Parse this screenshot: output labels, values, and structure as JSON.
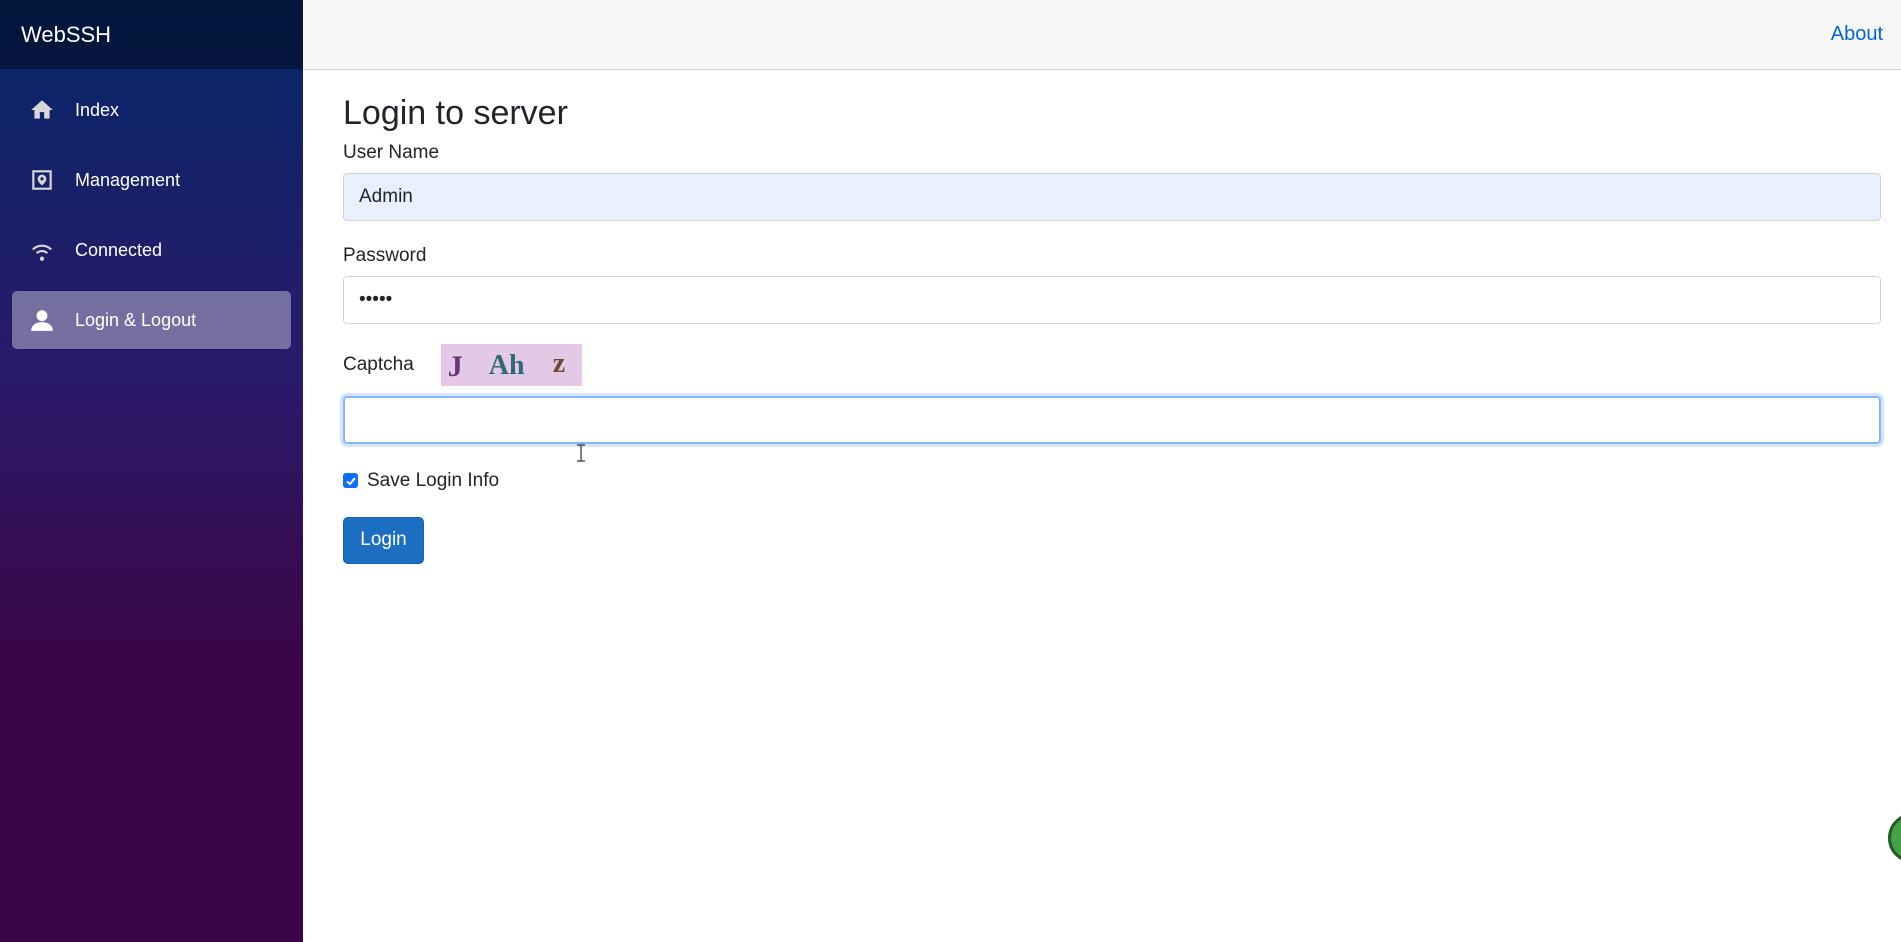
{
  "sidebar": {
    "brand": "WebSSH",
    "items": [
      {
        "label": "Index",
        "icon": "home-icon",
        "active": false
      },
      {
        "label": "Management",
        "icon": "management-icon",
        "active": false
      },
      {
        "label": "Connected",
        "icon": "wifi-icon",
        "active": false
      },
      {
        "label": "Login & Logout",
        "icon": "person-icon",
        "active": true
      }
    ]
  },
  "topbar": {
    "about_label": "About"
  },
  "main": {
    "title": "Login to server",
    "username_label": "User Name",
    "username_value": "Admin",
    "password_label": "Password",
    "password_value": "•••••",
    "captcha_label": "Captcha",
    "captcha_chars": [
      "J",
      "Ah",
      "z"
    ],
    "captcha_value": "",
    "save_login_label": "Save Login Info",
    "save_login_checked": true,
    "login_button": "Login"
  },
  "colors": {
    "accent": "#1b6ec2",
    "link": "#0366d6",
    "sidebar_top": "#052767",
    "sidebar_bottom": "#3a0647"
  }
}
